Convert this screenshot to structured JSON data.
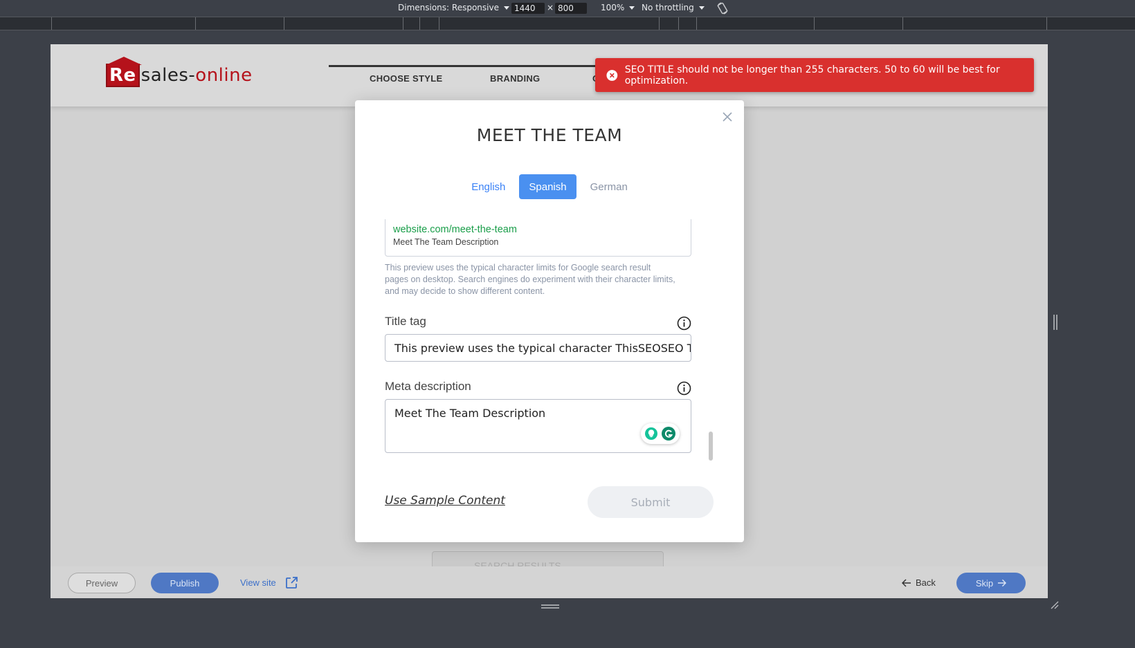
{
  "devtools": {
    "dimensions_label": "Dimensions: Responsive",
    "width_value": "1440",
    "times": "×",
    "height_value": "800",
    "zoom": "100%",
    "throttling": "No throttling",
    "rotate_icon": "rotate-icon"
  },
  "site": {
    "logo": {
      "re": "Re",
      "sales": "sales-",
      "online": "online"
    },
    "steps": [
      "CHOOSE STYLE",
      "BRANDING",
      "C"
    ],
    "ghost_card_label": "SEARCH RESULTS"
  },
  "bottom_bar": {
    "preview": "Preview",
    "publish": "Publish",
    "view_site": "View site",
    "back": "Back",
    "skip": "Skip"
  },
  "modal": {
    "title": "MEET THE TEAM",
    "tabs": [
      {
        "label": "English"
      },
      {
        "label": "Spanish"
      },
      {
        "label": "German"
      }
    ],
    "active_tab": "Spanish",
    "preview_url": "website.com/meet-the-team",
    "preview_description": "Meet The Team Description",
    "help_text": "This preview uses the typical character limits for Google search result pages on desktop. Search engines do experiment with their character limits, and may decide to show different content.",
    "title_tag_label": "Title tag",
    "title_tag_value": "This preview uses the typical character ThisSEOSEO T",
    "meta_description_label": "Meta description",
    "meta_description_value": "Meet The Team Description",
    "use_sample_content": "Use Sample Content",
    "submit": "Submit"
  },
  "toast": {
    "message": "SEO TITLE should not be longer than 255 characters. 50 to 60 will be best for optimization."
  },
  "colors": {
    "accent": "#4a90f0",
    "error": "#d9302e",
    "brand": "#b5121b",
    "url_green": "#1a9e4a"
  }
}
